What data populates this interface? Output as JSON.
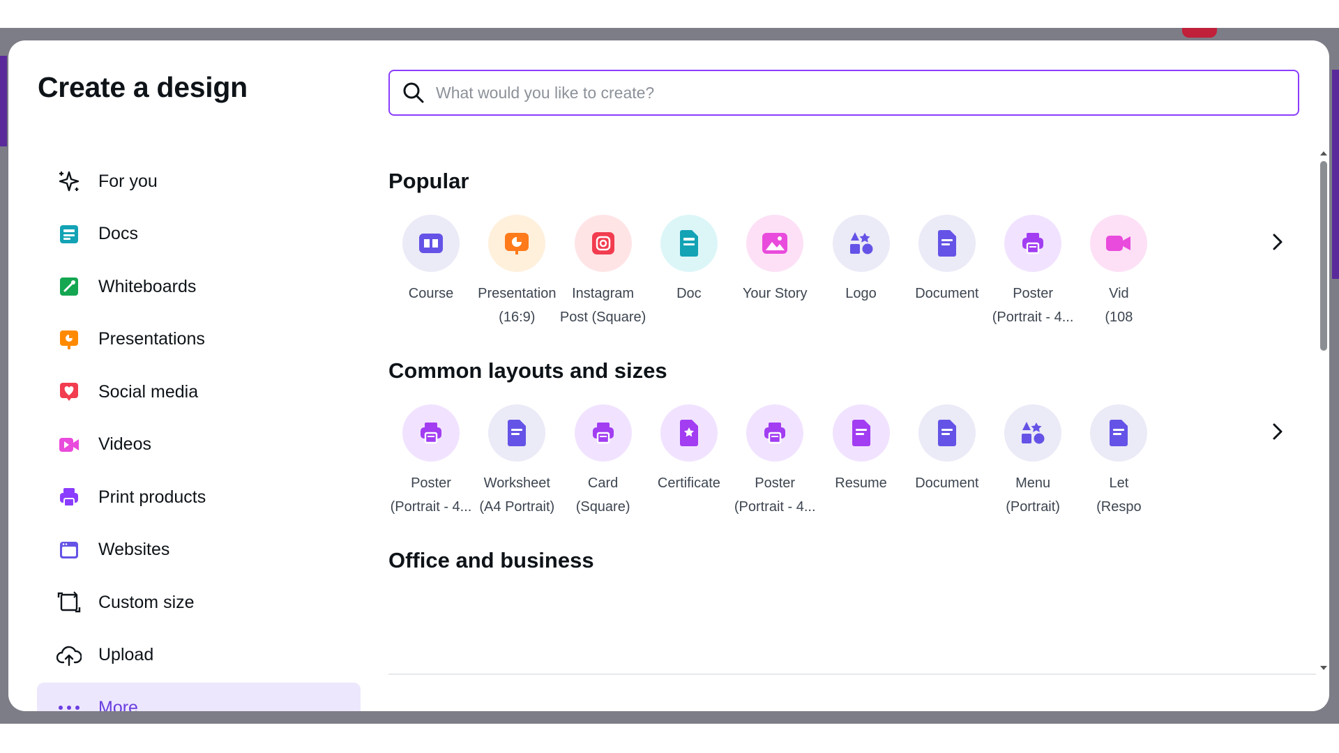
{
  "modal": {
    "title": "Create a design",
    "sidebar": [
      {
        "label": "For you",
        "icon": "sparkle-icon",
        "color": "#0e1318"
      },
      {
        "label": "Docs",
        "icon": "docs-icon",
        "color": "#13a3b5"
      },
      {
        "label": "Whiteboards",
        "icon": "whiteboard-icon",
        "color": "#14a651"
      },
      {
        "label": "Presentations",
        "icon": "presentation-icon",
        "color": "#ff8a00"
      },
      {
        "label": "Social media",
        "icon": "heart-icon",
        "color": "#f23c4f"
      },
      {
        "label": "Videos",
        "icon": "video-icon",
        "color": "#e94bdc"
      },
      {
        "label": "Print products",
        "icon": "print-icon",
        "color": "#8b3dff"
      },
      {
        "label": "Websites",
        "icon": "website-icon",
        "color": "#6453e6"
      },
      {
        "label": "Custom size",
        "icon": "custom-size-icon",
        "color": "#0e1318"
      },
      {
        "label": "Upload",
        "icon": "cloud-upload-icon",
        "color": "#0e1318"
      },
      {
        "label": "More",
        "icon": "more-dots-icon",
        "color": "#0e1318",
        "active": true
      }
    ],
    "search": {
      "placeholder": "What would you like to create?",
      "value": ""
    },
    "sections": [
      {
        "title": "Popular",
        "items": [
          {
            "label": "Course",
            "label2": "",
            "icon": "course-icon",
            "bg": "#ebeaf7",
            "fg": "#6453e6"
          },
          {
            "label": "Presentation",
            "label2": "(16:9)",
            "icon": "presentation-icon",
            "bg": "#fff0dc",
            "fg": "#ff7a1a"
          },
          {
            "label": "Instagram",
            "label2": "Post (Square)",
            "icon": "instagram-icon",
            "bg": "#ffe4e6",
            "fg": "#f23c4f"
          },
          {
            "label": "Doc",
            "label2": "",
            "icon": "doc-icon",
            "bg": "#dcf6f8",
            "fg": "#13a3b5"
          },
          {
            "label": "Your Story",
            "label2": "",
            "icon": "story-icon",
            "bg": "#fde0f6",
            "fg": "#e94bdc"
          },
          {
            "label": "Logo",
            "label2": "",
            "icon": "logo-shapes-icon",
            "bg": "#ebeaf7",
            "fg": "#6453e6"
          },
          {
            "label": "Document",
            "label2": "",
            "icon": "document-icon",
            "bg": "#ebeaf7",
            "fg": "#6453e6"
          },
          {
            "label": "Poster",
            "label2": "(Portrait - 4...",
            "icon": "poster-icon",
            "bg": "#f1e3ff",
            "fg": "#a23df2"
          },
          {
            "label": "Vid",
            "label2": "(108",
            "icon": "video-icon",
            "bg": "#fde0f6",
            "fg": "#e94bdc"
          }
        ]
      },
      {
        "title": "Common layouts and sizes",
        "items": [
          {
            "label": "Poster",
            "label2": "(Portrait - 4...",
            "icon": "poster-icon",
            "bg": "#f1e3ff",
            "fg": "#a23df2"
          },
          {
            "label": "Worksheet",
            "label2": "(A4 Portrait)",
            "icon": "worksheet-icon",
            "bg": "#ebeaf7",
            "fg": "#6453e6"
          },
          {
            "label": "Card",
            "label2": "(Square)",
            "icon": "card-icon",
            "bg": "#f1e3ff",
            "fg": "#a23df2"
          },
          {
            "label": "Certificate",
            "label2": "",
            "icon": "certificate-icon",
            "bg": "#f1e3ff",
            "fg": "#a23df2"
          },
          {
            "label": "Poster",
            "label2": "(Portrait - 4...",
            "icon": "poster-icon",
            "bg": "#f1e3ff",
            "fg": "#a23df2"
          },
          {
            "label": "Resume",
            "label2": "",
            "icon": "resume-icon",
            "bg": "#f1e3ff",
            "fg": "#a23df2"
          },
          {
            "label": "Document",
            "label2": "",
            "icon": "document-icon",
            "bg": "#ebeaf7",
            "fg": "#6453e6"
          },
          {
            "label": "Menu",
            "label2": "(Portrait)",
            "icon": "menu-shapes-icon",
            "bg": "#ebeaf7",
            "fg": "#6453e6"
          },
          {
            "label": "Let",
            "label2": "(Respo",
            "icon": "letter-icon",
            "bg": "#ebeaf7",
            "fg": "#6453e6"
          }
        ]
      },
      {
        "title": "Office and business",
        "items": []
      }
    ]
  },
  "colors": {
    "accent": "#8b3dff",
    "active_bg": "#ede7fd",
    "active_text": "#6a3ee0",
    "backdrop": "#7d7d87"
  }
}
